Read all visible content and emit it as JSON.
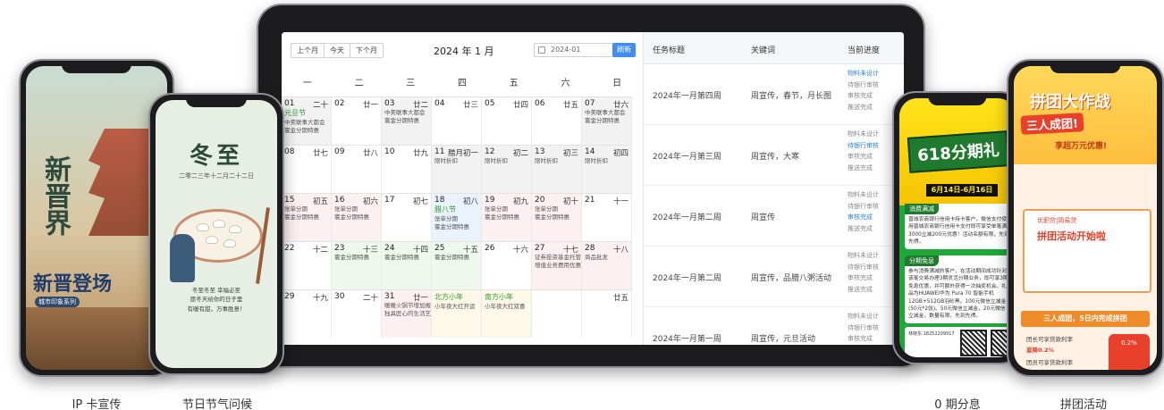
{
  "calendar": {
    "nav": [
      "上个月",
      "今天",
      "下个月"
    ],
    "title": "2024 年 1 月",
    "date_value": "2024-01",
    "refresh_label": "刷新",
    "weekdays": [
      "一",
      "二",
      "三",
      "四",
      "五",
      "六",
      "日"
    ],
    "weeks": [
      [
        {
          "d": "01",
          "l": "二十",
          "fest": "元旦节",
          "ev": [
            "中美联事大都会",
            "寰金分期特惠"
          ],
          "bg": "c-grey"
        },
        {
          "d": "02",
          "l": "廿一",
          "fest": "",
          "ev": [],
          "bg": ""
        },
        {
          "d": "03",
          "l": "廿二",
          "fest": "",
          "ev": [
            "中美联事大都会",
            "寰金分期特惠"
          ],
          "bg": "c-grey"
        },
        {
          "d": "04",
          "l": "廿三",
          "fest": "",
          "ev": [],
          "bg": ""
        },
        {
          "d": "05",
          "l": "廿四",
          "fest": "",
          "ev": [],
          "bg": ""
        },
        {
          "d": "06",
          "l": "廿五",
          "fest": "",
          "ev": [],
          "bg": ""
        },
        {
          "d": "07",
          "l": "廿六",
          "fest": "",
          "ev": [
            "中美联事大都会",
            "寰金分期特惠"
          ],
          "bg": "c-grey"
        }
      ],
      [
        {
          "d": "08",
          "l": "廿七",
          "fest": "",
          "ev": [],
          "bg": ""
        },
        {
          "d": "09",
          "l": "廿八",
          "fest": "",
          "ev": [],
          "bg": ""
        },
        {
          "d": "10",
          "l": "廿九",
          "fest": "",
          "ev": [],
          "bg": ""
        },
        {
          "d": "11",
          "l": "腊月初一",
          "fest": "",
          "ev": [
            "限时折扣"
          ],
          "bg": "c-grey"
        },
        {
          "d": "12",
          "l": "初二",
          "fest": "",
          "ev": [
            "限时折扣"
          ],
          "bg": "c-grey"
        },
        {
          "d": "13",
          "l": "初三",
          "fest": "",
          "ev": [
            "限时折扣"
          ],
          "bg": "c-grey"
        },
        {
          "d": "14",
          "l": "初四",
          "fest": "",
          "ev": [
            "限时折扣"
          ],
          "bg": "c-grey"
        }
      ],
      [
        {
          "d": "15",
          "l": "初五",
          "fest": "",
          "ev": [
            "张单分期",
            "寰金分期特惠"
          ],
          "bg": "c-pink"
        },
        {
          "d": "16",
          "l": "初六",
          "fest": "",
          "ev": [
            "张单分期",
            "寰金分期特惠"
          ],
          "bg": "c-pink"
        },
        {
          "d": "17",
          "l": "初七",
          "fest": "",
          "ev": [],
          "bg": ""
        },
        {
          "d": "18",
          "l": "初八",
          "fest": "腊八节",
          "ev": [
            "张单分期",
            "寰金分期特惠"
          ],
          "bg": "c-blue"
        },
        {
          "d": "19",
          "l": "初九",
          "fest": "",
          "ev": [
            "张单分期",
            "寰金分期特惠"
          ],
          "bg": "c-pink"
        },
        {
          "d": "20",
          "l": "初十",
          "fest": "",
          "ev": [
            "张单分期",
            "寰金分期特惠"
          ],
          "bg": "c-pink"
        },
        {
          "d": "21",
          "l": "十一",
          "fest": "",
          "ev": [],
          "bg": ""
        }
      ],
      [
        {
          "d": "22",
          "l": "十二",
          "fest": "",
          "ev": [],
          "bg": ""
        },
        {
          "d": "23",
          "l": "十三",
          "fest": "",
          "ev": [
            "寰金分期特惠"
          ],
          "bg": "c-green"
        },
        {
          "d": "24",
          "l": "十四",
          "fest": "",
          "ev": [
            "寰金分期特惠"
          ],
          "bg": "c-green"
        },
        {
          "d": "25",
          "l": "十五",
          "fest": "",
          "ev": [
            "寰金分期特惠"
          ],
          "bg": "c-green"
        },
        {
          "d": "26",
          "l": "十六",
          "fest": "",
          "ev": [],
          "bg": ""
        },
        {
          "d": "27",
          "l": "十七",
          "fest": "",
          "ev": [
            "证券投资基金托管",
            "增值业务费用优惠"
          ],
          "bg": "c-pink"
        },
        {
          "d": "28",
          "l": "十八",
          "fest": "",
          "ev": [
            "商品批发"
          ],
          "bg": "c-pink"
        }
      ],
      [
        {
          "d": "29",
          "l": "十九",
          "fest": "",
          "ev": [],
          "bg": ""
        },
        {
          "d": "30",
          "l": "二十",
          "fest": "",
          "ev": [],
          "bg": ""
        },
        {
          "d": "31",
          "l": "廿一",
          "fest": "",
          "ev": [
            "暖暖火锅节增加报",
            "独具匠心的生活艺术"
          ],
          "bg": "c-pink"
        },
        {
          "d": "",
          "l": "",
          "fest": "北方小年",
          "ev": [
            "小年夜大红开运"
          ],
          "bg": "c-yellow"
        },
        {
          "d": "",
          "l": "",
          "fest": "南方小年",
          "ev": [
            "小年夜大红双喜"
          ],
          "bg": "c-yellow"
        },
        {
          "d": "",
          "l": "",
          "fest": "",
          "ev": [],
          "bg": ""
        },
        {
          "d": "",
          "l": "廿五",
          "fest": "",
          "ev": [],
          "bg": ""
        }
      ]
    ]
  },
  "tasks": {
    "headers": [
      "任务标题",
      "关键词",
      "当前进度"
    ],
    "rows": [
      {
        "title": "2024年一月第四周",
        "keywords": "周宣传，春节，月长图",
        "progress": [
          "物料未设计",
          "待银行审核",
          "审核完成",
          "推送完成"
        ],
        "active": 0
      },
      {
        "title": "2024年一月第三周",
        "keywords": "周宣传，大寒",
        "progress": [
          "物料未设计",
          "待银行审核",
          "审核完成",
          "推送完成"
        ],
        "active": 1
      },
      {
        "title": "2024年一月第二周",
        "keywords": "周宣传",
        "progress": [
          "物料未设计",
          "待银行审核",
          "审核完成",
          "推送完成"
        ],
        "active": 2
      },
      {
        "title": "2024年一月第二周",
        "keywords": "周宣传，品腊八粥活动",
        "progress": [
          "物料未设计",
          "待银行审核",
          "审核完成",
          "推送完成"
        ],
        "active": -1
      },
      {
        "title": "2024年一月第一周",
        "keywords": "周宣传，元旦活动",
        "progress": [
          "物料未设计",
          "待银行审核",
          "审核完成",
          "推送完成"
        ],
        "active": -1
      }
    ]
  },
  "phone1": {
    "big_text": "新晋界",
    "title": "新晋登场",
    "subtitle": "城市印象系列"
  },
  "phone2": {
    "title": "冬至",
    "date": "二零二三年十二月二十二日",
    "text": [
      "冬至冬至 幸福必至",
      "愿冬天给你的日子里",
      "有暖有甜，万事胜意！"
    ]
  },
  "phone3": {
    "headline": "618分期礼",
    "dates": "6月14日-6月16日",
    "card1_tag": "消费满减",
    "card1_text": "晋城农商银行信用卡持卡客户，微信支付使用晋城农商银行信用卡支付即可享受单笔满3000立减200元优惠！活动名额有限，先到先得。",
    "card2_tag": "分期免息",
    "card2_text": "参与消费满减的客户，在活动期间成功针对该笔交易办理3期灵活分期业务，即可享3期免息优惠，并可额外获得一次抽奖机会。礼品为HUAWEI华为 Pura 70 智能手机12GB+512GB羽砂黑。100元微信立减金(50元*2张)、50元微信立减金，20元微信立减金，数量有限，先到先得。",
    "footer": "林晓东 18252209917"
  },
  "phone4": {
    "title": "拼团大作战",
    "chip": "三人成团!",
    "sub": "享超万元优惠!",
    "panel_line1": "优职贷|简易贷",
    "panel_line2": "拼团活动开始啦",
    "band": "三人成团，5日内完成拼团",
    "rate_label": "团长可享贷款利率",
    "rate1": "直降0.2%",
    "rate_label2": "团员可享贷款利率",
    "tag": "0.2%"
  },
  "captions": [
    "IP 卡宣传",
    "节日节气问候",
    "0 期分息",
    "拼团活动"
  ]
}
